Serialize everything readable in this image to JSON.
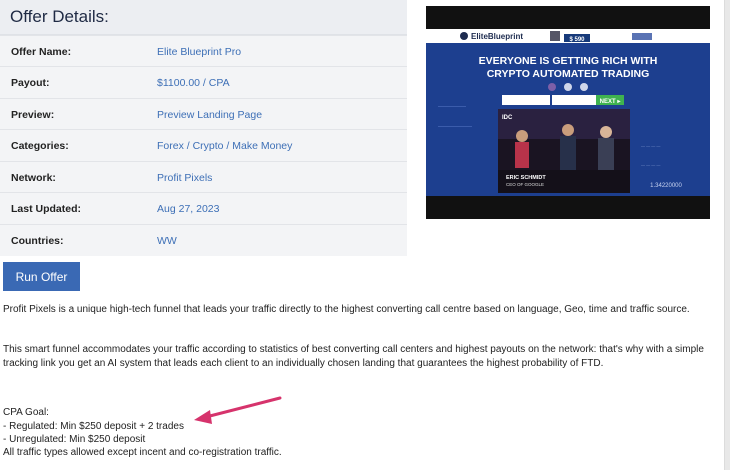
{
  "offer": {
    "title": "Offer Details:",
    "rows": [
      {
        "label": "Offer Name:",
        "value": "Elite Blueprint Pro"
      },
      {
        "label": "Payout:",
        "value": "$1100.00 / CPA"
      },
      {
        "label": "Preview:",
        "value": "Preview Landing Page"
      },
      {
        "label": "Categories:",
        "value": "Forex / Crypto / Make Money"
      },
      {
        "label": "Network:",
        "value": "Profit Pixels"
      },
      {
        "label": "Last Updated:",
        "value": "Aug 27, 2023"
      },
      {
        "label": "Countries:",
        "value": "WW"
      }
    ],
    "run_button": "Run Offer"
  },
  "preview_image": {
    "logo_text": "EliteBlueprint",
    "balance": "$ 590",
    "headline_line1": "EVERYONE IS GETTING RICH WITH",
    "headline_line2": "CRYPTO AUTOMATED TRADING",
    "cta": "NEXT ▸",
    "video_badge": "IDC",
    "caption_name": "ERIC SCHMIDT",
    "caption_title": "CEO OF GOOGLE",
    "side_number": "1.34220000"
  },
  "description": {
    "p1": "Profit Pixels is a unique high-tech funnel that leads your traffic directly to the highest converting call centre based on language, Geo, time and traffic source.",
    "p2": "This smart funnel accommodates your traffic according to statistics of best converting call centers and highest payouts on the network: that's why with a simple tracking link you get an AI system that leads each client to an individually chosen landing that guarantees the highest probability of FTD.",
    "goal_title": "CPA Goal:",
    "goal_regulated": "- Regulated: Min $250 deposit + 2 trades",
    "goal_unregulated": "- Unregulated: Min $250 deposit",
    "traffic": "All traffic types allowed except incent and co-registration traffic."
  },
  "colors": {
    "button": "#3a69b4",
    "link": "#3d6fb6",
    "arrow": "#d6336c"
  }
}
